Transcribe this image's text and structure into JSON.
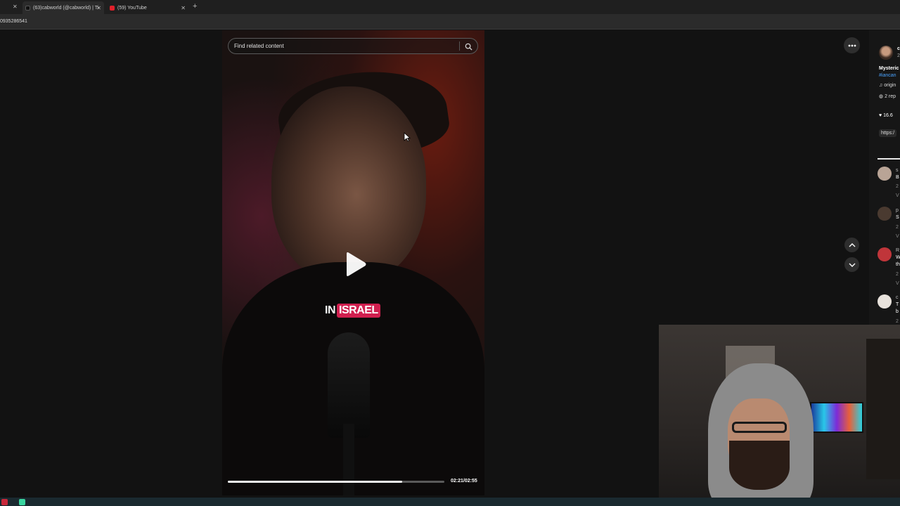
{
  "browser": {
    "tabs": [
      {
        "label": "(63)cabworld (@cabworld) | Ti",
        "favicon": "tiktok-icon",
        "active": true
      },
      {
        "label": "(59) YouTube",
        "favicon": "youtube-icon",
        "active": false
      }
    ],
    "address": "0935286541"
  },
  "search": {
    "placeholder": "Find related content"
  },
  "video": {
    "caption_word1": "IN",
    "caption_word2": "ISRAEL",
    "time": "02:21/02:55",
    "progress": 0.805
  },
  "sidebar": {
    "author_initial": "c",
    "author_sub": "2",
    "description": "Mysteric",
    "hashtag": "#iancan",
    "sound": "origin",
    "replies": "2 rep",
    "likes": "16.6",
    "link": "https:/",
    "comments": [
      {
        "user": "s",
        "text": "B",
        "meta": "2",
        "reply": "V"
      },
      {
        "user": "p",
        "text": "S",
        "meta": "2",
        "reply": "V"
      },
      {
        "user": "R",
        "text": "W",
        "text2": "th",
        "meta": "2",
        "reply": "V"
      },
      {
        "user": "c",
        "text": "T",
        "text2": "b",
        "meta": "2"
      }
    ]
  },
  "colors": {
    "accent": "#d11f4f",
    "link": "#4aa3ff"
  }
}
